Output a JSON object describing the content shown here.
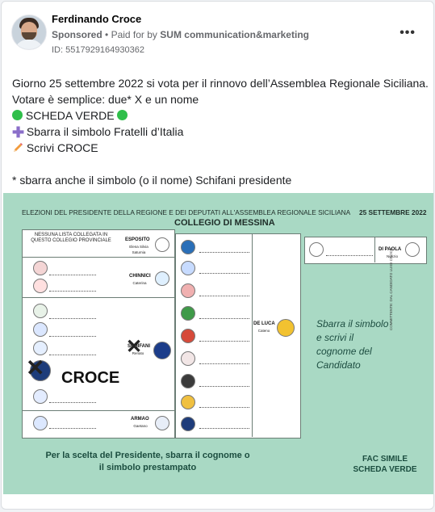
{
  "post": {
    "author": "Ferdinando Croce",
    "sponsored": "Sponsored",
    "paid_for_prefix": "Paid for by",
    "payer": "SUM communication&marketing",
    "ad_id": "ID: 5517929164930362",
    "more": "•••"
  },
  "body": {
    "line1": "Giorno 25 settembre 2022 si vota per il rinnovo dell’Assemblea Regionale Siciliana.",
    "line2": "Votare è semplice: due* X e un nome",
    "line3": "SCHEDA VERDE",
    "line4": "Sbarra il simbolo Fratelli d’Italia",
    "line5": "Scrivi CROCE",
    "line6": "* sbarra anche il simbolo (o il nome) Schifani presidente"
  },
  "ballot": {
    "header": "ELEZIONI DEL PRESIDENTE DELLA REGIONE E DEI DEPUTATI ALL'ASSEMBLEA REGIONALE SICILIANA",
    "date": "25 SETTEMBRE 2022",
    "collegio": "COLLEGIO DI MESSINA",
    "nessuna": "NESSUNA LISTA COLLEGATA IN QUESTO COLLEGIO PROVINCIALE",
    "esposito": "ESPOSITO",
    "esposito_sub": "Elena Silvia Saturnia",
    "chinnici": "CHINNICI",
    "chinnici_sub": "Caterina",
    "schifani": "SCHIFANI",
    "schifani_sub": "Renato",
    "armao": "ARMAO",
    "armao_sub": "Gaetano",
    "deluca": "DE LUCA",
    "deluca_sub": "Cateno",
    "dipaola": "DI PAOLA",
    "dipaola_sub": "Nunzio",
    "croce": "CROCE",
    "sbarra": "Sbarra il simbolo e scrivi il cognome del Candidato",
    "footer_left": "Per la scelta del Presidente, sbarra il cognome o il simbolo prestampato",
    "footer_right": "FAC SIMILE SCHEDA VERDE",
    "side_note": "COMMITTENTE: DAL CANDIDATO LUIGI CROCE"
  },
  "colors": {
    "ballot_bg": "#a9d9c4",
    "green_dot": "#2fbf4a",
    "text_green": "#1b4d3f"
  }
}
